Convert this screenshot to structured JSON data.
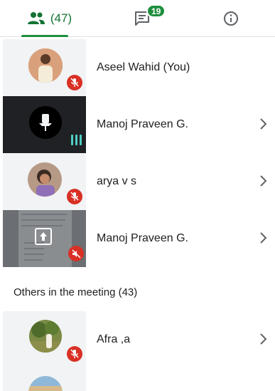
{
  "tabs": {
    "people_count": "(47)",
    "chat_badge": "19"
  },
  "participants": [
    {
      "name": "Aseel Wahid (You)",
      "mic": "muted",
      "tile": "photo"
    },
    {
      "name": "Manoj Praveen G.",
      "mic": "speaking",
      "tile": "placeholder"
    },
    {
      "name": "arya v s",
      "mic": "muted",
      "tile": "photo"
    },
    {
      "name": "Manoj Praveen G.",
      "mic": "muted",
      "tile": "screen-share"
    }
  ],
  "others": {
    "header": "Others in the meeting (43)",
    "participants": [
      {
        "name": "Afra ,a",
        "mic": "muted",
        "tile": "photo"
      }
    ]
  },
  "colors": {
    "accent": "#1e8e3e",
    "muted_red": "#d93025",
    "speaking": "#4ecdc4"
  }
}
